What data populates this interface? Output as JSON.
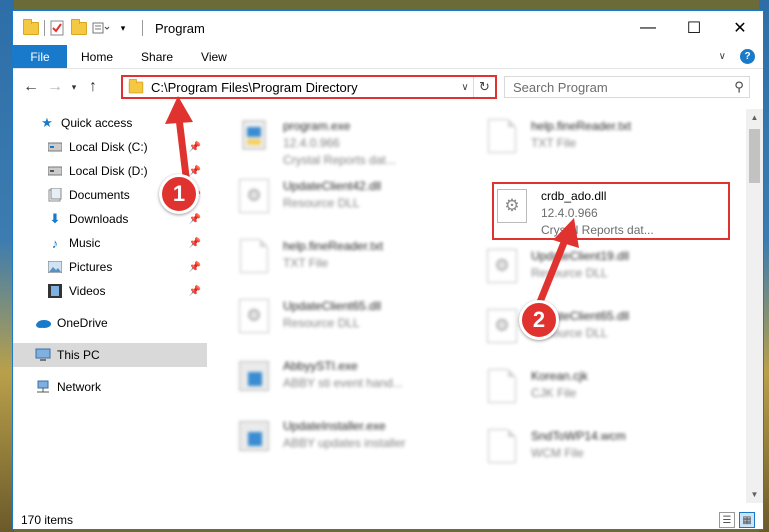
{
  "window": {
    "title": "Program",
    "controls": {
      "minimize": "—",
      "maximize": "☐",
      "close": "✕"
    }
  },
  "ribbon": {
    "tabs": [
      "File",
      "Home",
      "Share",
      "View"
    ]
  },
  "address": {
    "path": "C:\\Program Files\\Program Directory",
    "search_placeholder": "Search Program"
  },
  "sidebar": {
    "items": [
      {
        "label": "Quick access",
        "icon": "star-icon",
        "pinned": false
      },
      {
        "label": "Local Disk (C:)",
        "icon": "drive-icon",
        "pinned": true
      },
      {
        "label": "Local Disk (D:)",
        "icon": "drive-icon",
        "pinned": true
      },
      {
        "label": "Documents",
        "icon": "documents-icon",
        "pinned": true
      },
      {
        "label": "Downloads",
        "icon": "download-icon",
        "pinned": true
      },
      {
        "label": "Music",
        "icon": "music-icon",
        "pinned": true
      },
      {
        "label": "Pictures",
        "icon": "pictures-icon",
        "pinned": true
      },
      {
        "label": "Videos",
        "icon": "videos-icon",
        "pinned": true
      },
      {
        "label": "OneDrive",
        "icon": "cloud-icon",
        "pinned": false
      },
      {
        "label": "This PC",
        "icon": "computer-icon",
        "pinned": false,
        "selected": true
      },
      {
        "label": "Network",
        "icon": "network-icon",
        "pinned": false
      }
    ]
  },
  "files": [
    {
      "name": "program.exe",
      "line2": "12.4.0.966",
      "line3": "Crystal Reports dat...",
      "icon": "program-icon"
    },
    {
      "name": "help.fineReader.txt",
      "line2": "TXT File",
      "icon": "text-file-icon"
    },
    {
      "name": "UpdateClient42.dll",
      "line2": "Resource DLL",
      "icon": "dll-icon"
    },
    {
      "name": "crdb_ado.dll",
      "line2": "12.4.0.966",
      "line3": "Crystal Reports dat...",
      "icon": "dll-icon",
      "highlighted": true
    },
    {
      "name": "help.fineReader.txt",
      "line2": "TXT File",
      "icon": "text-file-icon"
    },
    {
      "name": "UpdateClient19.dll",
      "line2": "Resource DLL",
      "icon": "dll-icon"
    },
    {
      "name": "UpdateClient65.dll",
      "line2": "Resource DLL",
      "icon": "dll-icon"
    },
    {
      "name": "UpdateClient65.dll",
      "line2": "Resource DLL",
      "icon": "dll-icon"
    },
    {
      "name": "AbbyySTI.exe",
      "line2": "ABBY sti event hand...",
      "icon": "exe-icon"
    },
    {
      "name": "Korean.cjk",
      "line2": "CJK File",
      "icon": "text-file-icon"
    },
    {
      "name": "UpdateInstaller.exe",
      "line2": "ABBY updates installer",
      "icon": "exe-icon"
    },
    {
      "name": "SndToWP14.wcm",
      "line2": "WCM File",
      "icon": "text-file-icon"
    }
  ],
  "status": {
    "item_count": "170 items"
  },
  "annotations": [
    "1",
    "2"
  ],
  "colors": {
    "accent": "#1979ca",
    "highlight": "#e0332f"
  }
}
